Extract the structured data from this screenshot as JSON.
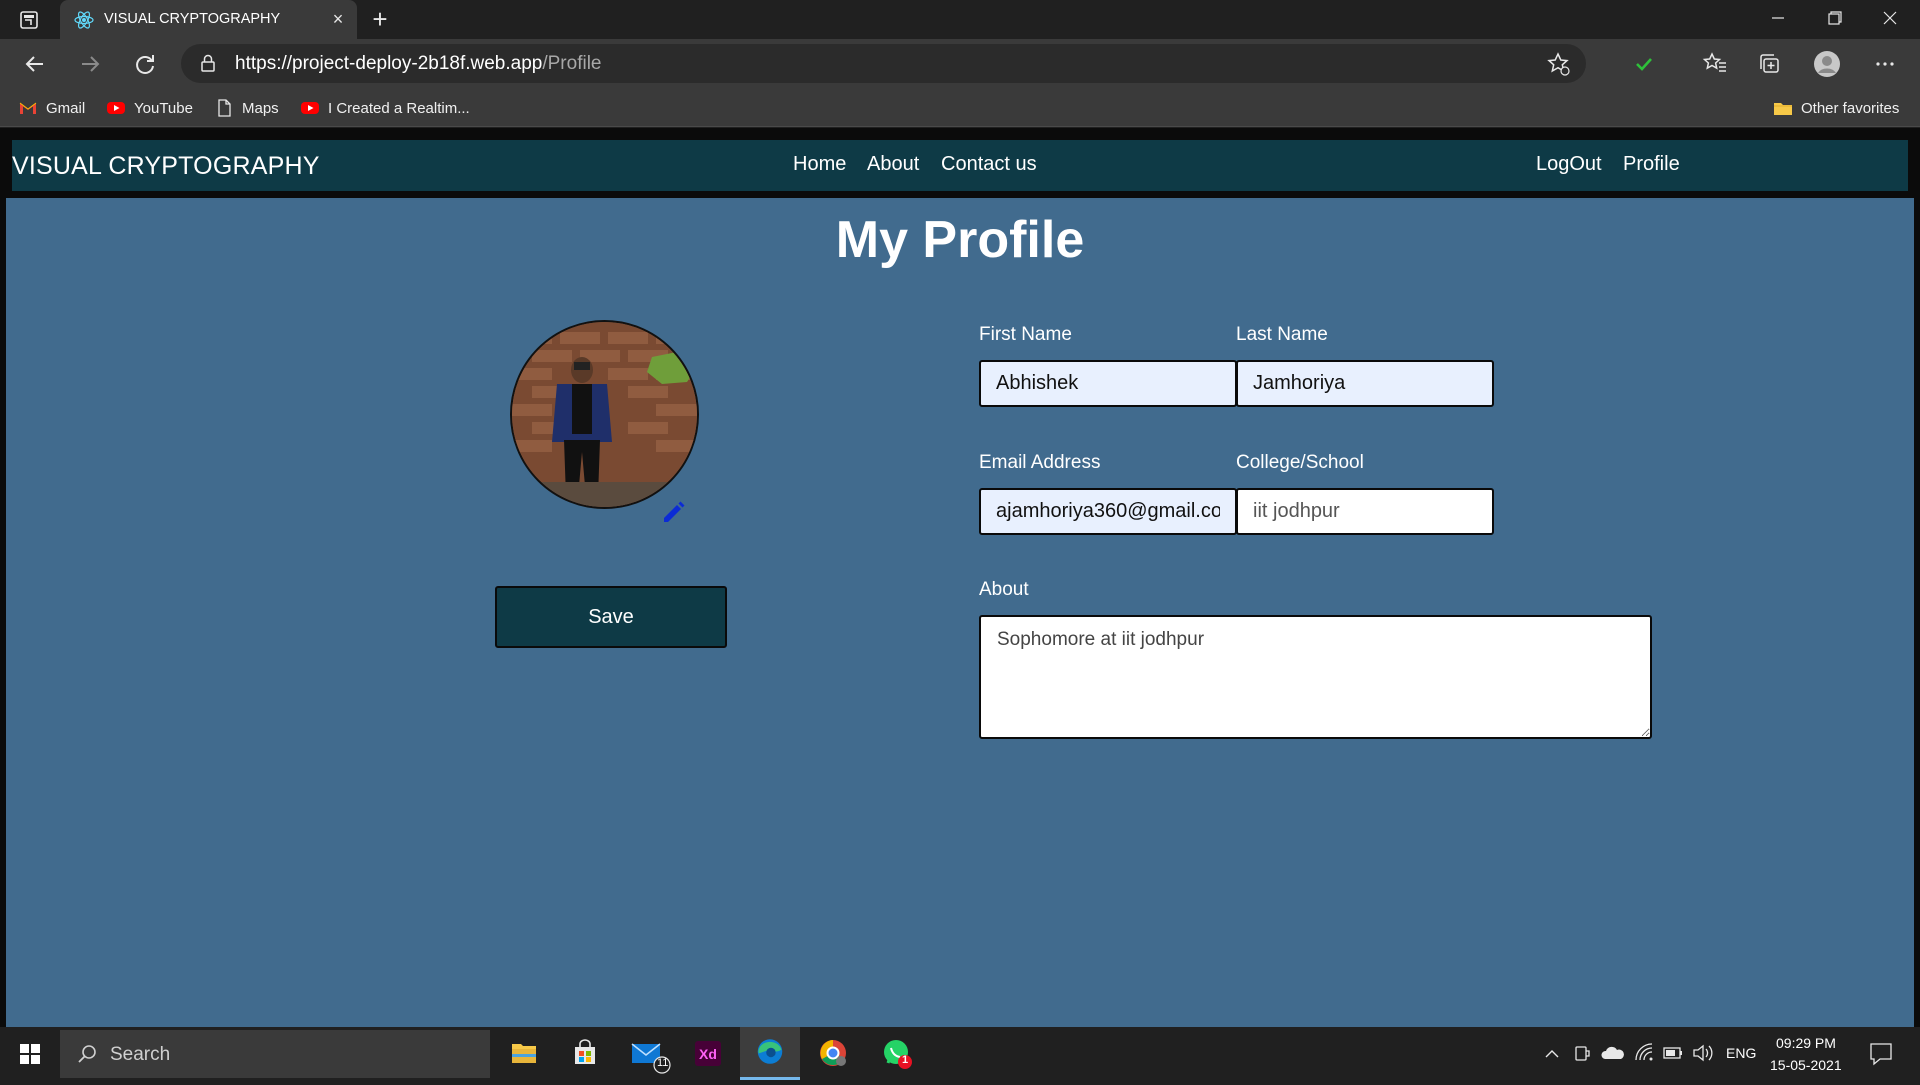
{
  "browser": {
    "tab_title": "VISUAL CRYPTOGRAPHY",
    "tab_close": "×",
    "new_tab": "+",
    "url_host": "https://project-deploy-2b18f.web.app",
    "url_path": "/Profile",
    "bookmarks": [
      {
        "label": "Gmail",
        "icon": "gmail-icon"
      },
      {
        "label": "YouTube",
        "icon": "youtube-icon"
      },
      {
        "label": "Maps",
        "icon": "page-icon"
      },
      {
        "label": "I Created a Realtim...",
        "icon": "youtube-icon"
      }
    ],
    "other_favorites": "Other favorites"
  },
  "site": {
    "brand": "VISUAL CRYPTOGRAPHY",
    "nav": [
      "Home",
      "About",
      "Contact us"
    ],
    "nav_right": [
      "LogOut",
      "Profile"
    ],
    "colors": {
      "navbar": "#0e3a46",
      "background": "#416b8e"
    }
  },
  "profile": {
    "title": "My Profile",
    "save_label": "Save",
    "first_name_label": "First Name",
    "first_name_value": "Abhishek",
    "last_name_label": "Last Name",
    "last_name_value": "Jamhoriya",
    "email_label": "Email Address",
    "email_value": "ajamhoriya360@gmail.co",
    "college_label": "College/School",
    "college_value": "iit jodhpur",
    "about_label": "About",
    "about_value": "Sophomore at iit jodhpur"
  },
  "taskbar": {
    "search_placeholder": "Search",
    "mail_badge": "11",
    "whatsapp_badge": "1",
    "lang": "ENG",
    "time": "09:29 PM",
    "date": "15-05-2021"
  }
}
